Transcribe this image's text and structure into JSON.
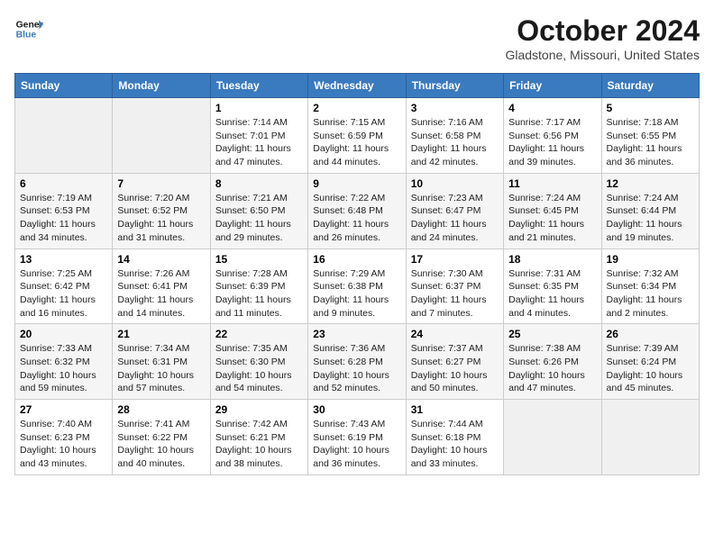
{
  "header": {
    "logo_general": "General",
    "logo_blue": "Blue",
    "month": "October 2024",
    "location": "Gladstone, Missouri, United States"
  },
  "weekdays": [
    "Sunday",
    "Monday",
    "Tuesday",
    "Wednesday",
    "Thursday",
    "Friday",
    "Saturday"
  ],
  "weeks": [
    [
      {
        "day": null
      },
      {
        "day": null
      },
      {
        "day": "1",
        "sunrise": "Sunrise: 7:14 AM",
        "sunset": "Sunset: 7:01 PM",
        "daylight": "Daylight: 11 hours and 47 minutes."
      },
      {
        "day": "2",
        "sunrise": "Sunrise: 7:15 AM",
        "sunset": "Sunset: 6:59 PM",
        "daylight": "Daylight: 11 hours and 44 minutes."
      },
      {
        "day": "3",
        "sunrise": "Sunrise: 7:16 AM",
        "sunset": "Sunset: 6:58 PM",
        "daylight": "Daylight: 11 hours and 42 minutes."
      },
      {
        "day": "4",
        "sunrise": "Sunrise: 7:17 AM",
        "sunset": "Sunset: 6:56 PM",
        "daylight": "Daylight: 11 hours and 39 minutes."
      },
      {
        "day": "5",
        "sunrise": "Sunrise: 7:18 AM",
        "sunset": "Sunset: 6:55 PM",
        "daylight": "Daylight: 11 hours and 36 minutes."
      }
    ],
    [
      {
        "day": "6",
        "sunrise": "Sunrise: 7:19 AM",
        "sunset": "Sunset: 6:53 PM",
        "daylight": "Daylight: 11 hours and 34 minutes."
      },
      {
        "day": "7",
        "sunrise": "Sunrise: 7:20 AM",
        "sunset": "Sunset: 6:52 PM",
        "daylight": "Daylight: 11 hours and 31 minutes."
      },
      {
        "day": "8",
        "sunrise": "Sunrise: 7:21 AM",
        "sunset": "Sunset: 6:50 PM",
        "daylight": "Daylight: 11 hours and 29 minutes."
      },
      {
        "day": "9",
        "sunrise": "Sunrise: 7:22 AM",
        "sunset": "Sunset: 6:48 PM",
        "daylight": "Daylight: 11 hours and 26 minutes."
      },
      {
        "day": "10",
        "sunrise": "Sunrise: 7:23 AM",
        "sunset": "Sunset: 6:47 PM",
        "daylight": "Daylight: 11 hours and 24 minutes."
      },
      {
        "day": "11",
        "sunrise": "Sunrise: 7:24 AM",
        "sunset": "Sunset: 6:45 PM",
        "daylight": "Daylight: 11 hours and 21 minutes."
      },
      {
        "day": "12",
        "sunrise": "Sunrise: 7:24 AM",
        "sunset": "Sunset: 6:44 PM",
        "daylight": "Daylight: 11 hours and 19 minutes."
      }
    ],
    [
      {
        "day": "13",
        "sunrise": "Sunrise: 7:25 AM",
        "sunset": "Sunset: 6:42 PM",
        "daylight": "Daylight: 11 hours and 16 minutes."
      },
      {
        "day": "14",
        "sunrise": "Sunrise: 7:26 AM",
        "sunset": "Sunset: 6:41 PM",
        "daylight": "Daylight: 11 hours and 14 minutes."
      },
      {
        "day": "15",
        "sunrise": "Sunrise: 7:28 AM",
        "sunset": "Sunset: 6:39 PM",
        "daylight": "Daylight: 11 hours and 11 minutes."
      },
      {
        "day": "16",
        "sunrise": "Sunrise: 7:29 AM",
        "sunset": "Sunset: 6:38 PM",
        "daylight": "Daylight: 11 hours and 9 minutes."
      },
      {
        "day": "17",
        "sunrise": "Sunrise: 7:30 AM",
        "sunset": "Sunset: 6:37 PM",
        "daylight": "Daylight: 11 hours and 7 minutes."
      },
      {
        "day": "18",
        "sunrise": "Sunrise: 7:31 AM",
        "sunset": "Sunset: 6:35 PM",
        "daylight": "Daylight: 11 hours and 4 minutes."
      },
      {
        "day": "19",
        "sunrise": "Sunrise: 7:32 AM",
        "sunset": "Sunset: 6:34 PM",
        "daylight": "Daylight: 11 hours and 2 minutes."
      }
    ],
    [
      {
        "day": "20",
        "sunrise": "Sunrise: 7:33 AM",
        "sunset": "Sunset: 6:32 PM",
        "daylight": "Daylight: 10 hours and 59 minutes."
      },
      {
        "day": "21",
        "sunrise": "Sunrise: 7:34 AM",
        "sunset": "Sunset: 6:31 PM",
        "daylight": "Daylight: 10 hours and 57 minutes."
      },
      {
        "day": "22",
        "sunrise": "Sunrise: 7:35 AM",
        "sunset": "Sunset: 6:30 PM",
        "daylight": "Daylight: 10 hours and 54 minutes."
      },
      {
        "day": "23",
        "sunrise": "Sunrise: 7:36 AM",
        "sunset": "Sunset: 6:28 PM",
        "daylight": "Daylight: 10 hours and 52 minutes."
      },
      {
        "day": "24",
        "sunrise": "Sunrise: 7:37 AM",
        "sunset": "Sunset: 6:27 PM",
        "daylight": "Daylight: 10 hours and 50 minutes."
      },
      {
        "day": "25",
        "sunrise": "Sunrise: 7:38 AM",
        "sunset": "Sunset: 6:26 PM",
        "daylight": "Daylight: 10 hours and 47 minutes."
      },
      {
        "day": "26",
        "sunrise": "Sunrise: 7:39 AM",
        "sunset": "Sunset: 6:24 PM",
        "daylight": "Daylight: 10 hours and 45 minutes."
      }
    ],
    [
      {
        "day": "27",
        "sunrise": "Sunrise: 7:40 AM",
        "sunset": "Sunset: 6:23 PM",
        "daylight": "Daylight: 10 hours and 43 minutes."
      },
      {
        "day": "28",
        "sunrise": "Sunrise: 7:41 AM",
        "sunset": "Sunset: 6:22 PM",
        "daylight": "Daylight: 10 hours and 40 minutes."
      },
      {
        "day": "29",
        "sunrise": "Sunrise: 7:42 AM",
        "sunset": "Sunset: 6:21 PM",
        "daylight": "Daylight: 10 hours and 38 minutes."
      },
      {
        "day": "30",
        "sunrise": "Sunrise: 7:43 AM",
        "sunset": "Sunset: 6:19 PM",
        "daylight": "Daylight: 10 hours and 36 minutes."
      },
      {
        "day": "31",
        "sunrise": "Sunrise: 7:44 AM",
        "sunset": "Sunset: 6:18 PM",
        "daylight": "Daylight: 10 hours and 33 minutes."
      },
      {
        "day": null
      },
      {
        "day": null
      }
    ]
  ]
}
